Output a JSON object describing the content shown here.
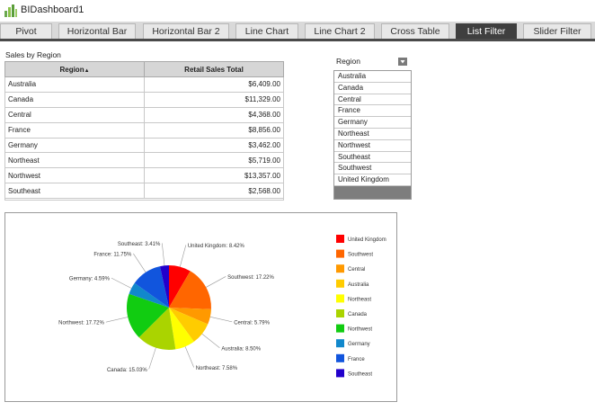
{
  "app": {
    "title": "BIDashboard1"
  },
  "tabs": [
    {
      "label": "Pivot"
    },
    {
      "label": "Horizontal Bar"
    },
    {
      "label": "Horizontal Bar 2"
    },
    {
      "label": "Line Chart"
    },
    {
      "label": "Line Chart 2"
    },
    {
      "label": "Cross Table"
    },
    {
      "label": "List Filter"
    },
    {
      "label": "Slider Filter"
    }
  ],
  "active_tab": "List Filter",
  "sales_table": {
    "title": "Sales by Region",
    "columns": [
      "Region",
      "Retail Sales Total"
    ],
    "rows": [
      [
        "Australia",
        "$6,409.00"
      ],
      [
        "Canada",
        "$11,329.00"
      ],
      [
        "Central",
        "$4,368.00"
      ],
      [
        "France",
        "$8,856.00"
      ],
      [
        "Germany",
        "$3,462.00"
      ],
      [
        "Northeast",
        "$5,719.00"
      ],
      [
        "Northwest",
        "$13,357.00"
      ],
      [
        "Southeast",
        "$2,568.00"
      ]
    ]
  },
  "region_filter": {
    "title": "Region",
    "items": [
      "Australia",
      "Canada",
      "Central",
      "France",
      "Germany",
      "Northeast",
      "Northwest",
      "Southeast",
      "Southwest",
      "United Kingdom"
    ]
  },
  "chart_data": {
    "type": "pie",
    "title": "",
    "slices": [
      {
        "label": "United Kingdom",
        "value": 8.42,
        "display": "United Kingdom: 8.42%",
        "color": "#ff0000"
      },
      {
        "label": "Southwest",
        "value": 17.22,
        "display": "Southwest: 17.22%",
        "color": "#ff6600"
      },
      {
        "label": "Central",
        "value": 5.79,
        "display": "Central: 5.79%",
        "color": "#ff9900"
      },
      {
        "label": "Australia",
        "value": 8.5,
        "display": "Australia: 8.50%",
        "color": "#ffcc00"
      },
      {
        "label": "Northeast",
        "value": 7.58,
        "display": "Northeast: 7.58%",
        "color": "#ffff00"
      },
      {
        "label": "Canada",
        "value": 15.03,
        "display": "Canada: 15.03%",
        "color": "#aad400"
      },
      {
        "label": "Northwest",
        "value": 17.72,
        "display": "Northwest: 17.72%",
        "color": "#11cc11"
      },
      {
        "label": "Germany",
        "value": 4.59,
        "display": "Germany: 4.59%",
        "color": "#1188cc"
      },
      {
        "label": "France",
        "value": 11.75,
        "display": "France: 11.75%",
        "color": "#1155dd"
      },
      {
        "label": "Southeast",
        "value": 3.41,
        "display": "Southeast: 3.41%",
        "color": "#2200cc"
      }
    ],
    "legend": [
      "United Kingdom",
      "Southwest",
      "Central",
      "Australia",
      "Northeast",
      "Canada",
      "Northwest",
      "Germany",
      "France",
      "Southeast"
    ],
    "legend_placement": "right"
  }
}
